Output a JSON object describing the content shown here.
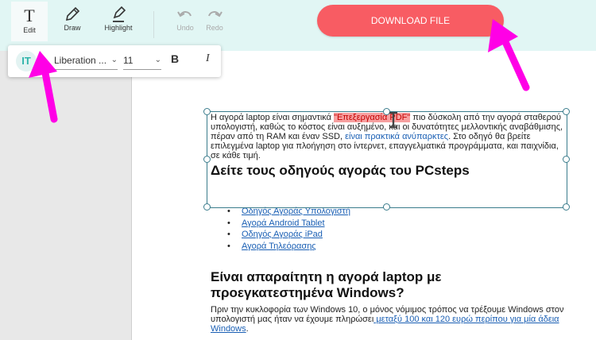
{
  "toolbar": {
    "edit_label": "Edit",
    "draw_label": "Draw",
    "highlight_label": "Highlight",
    "undo_label": "Undo",
    "redo_label": "Redo",
    "download_label": "DOWNLOAD FILE"
  },
  "font_toolbar": {
    "text_icon": "IT",
    "font_family": "Liberation ...",
    "font_size": "11",
    "bold_label": "B",
    "italic_label": "I"
  },
  "document": {
    "para1_a": "Η αγορά laptop είναι σημαντικά ",
    "para1_highlight": "\"Επεξεργασία PDF\"",
    "para1_b": " πιο δύσκολη από την αγορά σταθερού υπολογιστή, καθώς το κόστος είναι αυξημένο, και οι δυνατότητες μελλοντικής αναβάθμισης, πέραν από τη RAM και έναν SSD, ",
    "para1_link": "είναι πρακτικά ανύπαρκτες",
    "para1_c": ". Στο οδηγό θα βρείτε επιλεγμένα laptop για πλοήγηση στο ίντερνετ, επαγγελματικά προγράμματα, και παιχνίδια, σε κάθε τιμή.",
    "heading1": "Δείτε τους οδηγούς αγοράς του PCsteps",
    "bullets": [
      "Οδηγός Αγοράς Υπολογιστή",
      "Αγορά Android Tablet",
      "Οδηγός Αγοράς iPad",
      "Αγορά Τηλεόρασης"
    ],
    "heading2": "Είναι απαραίτητη η αγορά laptop με προεγκατεστημένα Windows?",
    "para2_a": "Πριν την κυκλοφορία των Windows 10, ο μόνος νόμιμος τρόπος να τρέξουμε Windows στον υπολογιστή μας ήταν να έχουμε πληρώσει",
    "para2_link": " μεταξύ 100 και 120 ευρώ περίπου για μία άδεια Windows",
    "para2_b": "."
  },
  "colors": {
    "accent": "#f85c63",
    "topbar": "#e1f6f4",
    "selection": "#3a7c8c",
    "annotation_arrow": "#ff00e6"
  }
}
